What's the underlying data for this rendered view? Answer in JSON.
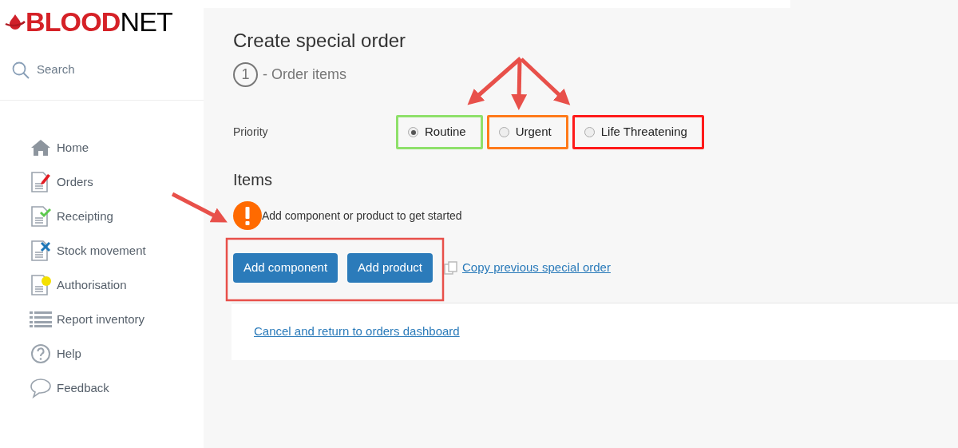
{
  "logo": {
    "part_1": "BLOOD",
    "part_2": "NET"
  },
  "search": {
    "placeholder": "Search"
  },
  "sidebar": {
    "items": [
      {
        "label": "Home",
        "kind": "home"
      },
      {
        "label": "Orders",
        "kind": "orders"
      },
      {
        "label": "Receipting",
        "kind": "receipting"
      },
      {
        "label": "Stock movement",
        "kind": "stock"
      },
      {
        "label": "Authorisation",
        "kind": "authorisation"
      },
      {
        "label": "Report inventory",
        "kind": "list"
      },
      {
        "label": "Help",
        "kind": "help"
      },
      {
        "label": "Feedback",
        "kind": "feedback"
      }
    ]
  },
  "page": {
    "title": "Create special order",
    "step_number": "1",
    "step_label": "- Order items"
  },
  "priority": {
    "label": "Priority",
    "options": [
      {
        "label": "Routine",
        "selected": true,
        "color": "#8ee06a"
      },
      {
        "label": "Urgent",
        "selected": false,
        "color": "#ff7a1a"
      },
      {
        "label": "Life Threatening",
        "selected": false,
        "color": "#ff1a1a"
      }
    ]
  },
  "items": {
    "heading": "Items",
    "alert": "Add component or product to get started",
    "buttons": [
      "Add component",
      "Add product"
    ],
    "copy_link": "Copy previous special order"
  },
  "footer": {
    "cancel_link": "Cancel and return to orders dashboard"
  }
}
